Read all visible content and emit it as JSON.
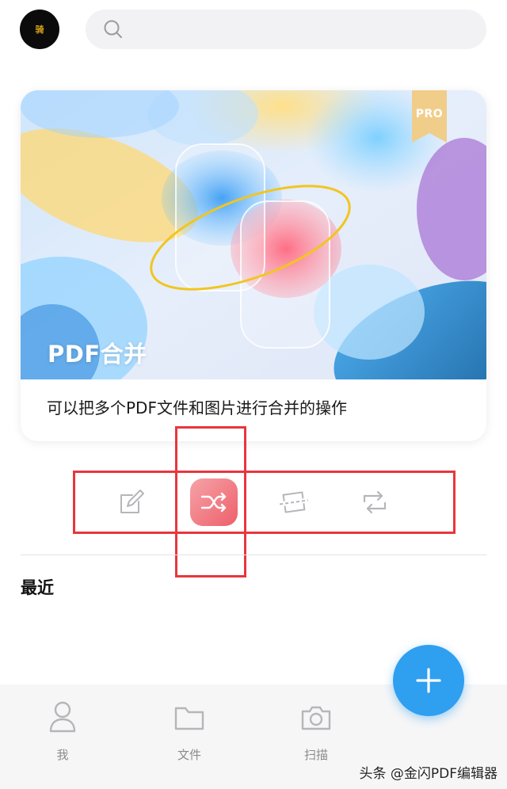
{
  "header": {
    "avatar_mark": "骑",
    "search_icon": "search-icon"
  },
  "feature_card": {
    "badge": "PRO",
    "title": "PDF合并",
    "description": "可以把多个PDF文件和图片进行合并的操作"
  },
  "tools": [
    {
      "icon": "edit-icon",
      "active": false
    },
    {
      "icon": "shuffle-merge-icon",
      "active": true
    },
    {
      "icon": "split-icon",
      "active": false
    },
    {
      "icon": "convert-icon",
      "active": false
    }
  ],
  "recent": {
    "heading": "最近"
  },
  "bottom_nav": [
    {
      "label": "我",
      "icon": "user-icon"
    },
    {
      "label": "文件",
      "icon": "folder-icon"
    },
    {
      "label": "扫描",
      "icon": "camera-icon"
    }
  ],
  "fab": {
    "icon": "plus-icon"
  },
  "watermark": "头条 @金闪PDF编辑器",
  "colors": {
    "accent": "#2f9ff0",
    "highlight_red": "#e8363d",
    "active_tool": "#ee5f6a"
  }
}
